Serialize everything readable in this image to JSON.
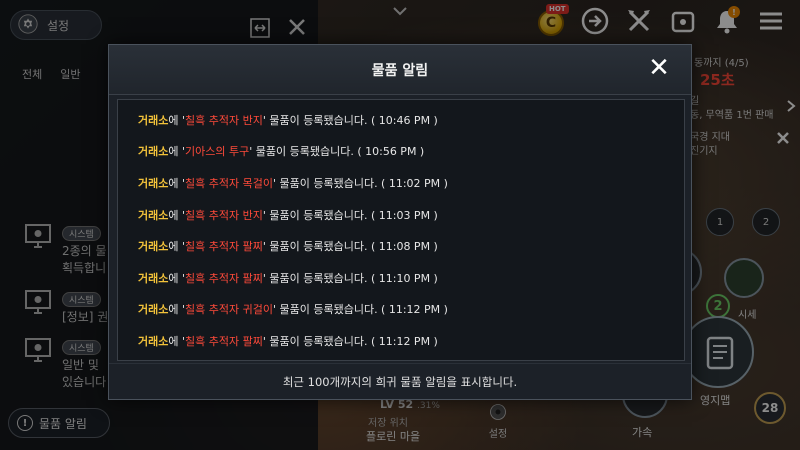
{
  "left_panel": {
    "settings_label": "설정",
    "tabs": [
      "전체",
      "일반"
    ],
    "messages": [
      {
        "badge": "시스템",
        "lines": [
          "2종의 물",
          "획득합니"
        ]
      },
      {
        "badge": "시스템",
        "lines": [
          "[정보] 권"
        ]
      },
      {
        "badge": "시스템",
        "lines": [
          "일반 및 ",
          "있습니다"
        ]
      }
    ],
    "item_alert_label": "물품 알림",
    "alert_icon_char": "!"
  },
  "top_hud": {
    "hot_badge": "HOT",
    "coin_char": "C",
    "notification_count": "!"
  },
  "right_hud": {
    "quest_head": "동까지 (4/5)",
    "quest_timer": "25초",
    "row1": "길",
    "row2": "동, 무역품 1번 판매",
    "row3": "국경 지대",
    "row4": "진기지",
    "flag1": "1",
    "flag2": "2",
    "sise": "시세",
    "two": "2",
    "map_label": "영지맵",
    "accel_label": "가속",
    "level_badge": "28"
  },
  "bottom_hud": {
    "level": "LV 52",
    "level_pct": ".31%",
    "save_pos": "저장 위치",
    "place": "플로린 마을",
    "setting": "설정"
  },
  "modal": {
    "title": "물품 알림",
    "close": "✕",
    "alerts": [
      {
        "place": "거래소",
        "mid": "에 '",
        "item": "칠흑 추적자 반지",
        "tail": "' 물품이 등록됐습니다. ( 10:46 PM )"
      },
      {
        "place": "거래소",
        "mid": "에 '",
        "item": "기아스의 투구",
        "tail": "' 물품이 등록됐습니다. ( 10:56 PM )"
      },
      {
        "place": "거래소",
        "mid": "에 '",
        "item": "칠흑 추적자 목걸이",
        "tail": "' 물품이 등록됐습니다. ( 11:02 PM )"
      },
      {
        "place": "거래소",
        "mid": "에 '",
        "item": "칠흑 추적자 반지",
        "tail": "' 물품이 등록됐습니다. ( 11:03 PM )"
      },
      {
        "place": "거래소",
        "mid": "에 '",
        "item": "칠흑 추적자 팔찌",
        "tail": "' 물품이 등록됐습니다. ( 11:08 PM )"
      },
      {
        "place": "거래소",
        "mid": "에 '",
        "item": "칠흑 추적자 팔찌",
        "tail": "' 물품이 등록됐습니다. ( 11:10 PM )"
      },
      {
        "place": "거래소",
        "mid": "에 '",
        "item": "칠흑 추적자 귀걸이",
        "tail": "' 물품이 등록됐습니다. ( 11:12 PM )"
      },
      {
        "place": "거래소",
        "mid": "에 '",
        "item": "칠흑 추적자 팔찌",
        "tail": "' 물품이 등록됐습니다. ( 11:12 PM )"
      }
    ],
    "footer": "최근 100개까지의 희귀 물품 알림을 표시합니다."
  },
  "colors": {
    "place_highlight": "#f2c23a",
    "item_highlight": "#ff4a3a",
    "quest_timer": "#ff4a3a"
  }
}
